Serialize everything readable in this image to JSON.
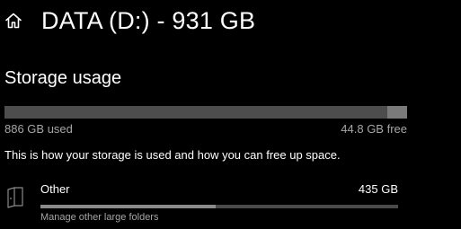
{
  "header": {
    "icon": "home-icon",
    "title": "DATA (D:) - 931 GB"
  },
  "storage": {
    "section_title": "Storage usage",
    "used_label": "886 GB used",
    "free_label": "44.8 GB free",
    "used_fraction": 0.95,
    "description": "This is how your storage is used and how you can free up space."
  },
  "categories": [
    {
      "icon": "folder-icon",
      "name": "Other",
      "size": "435 GB",
      "fill_fraction": 0.49,
      "subtitle": "Manage other large folders"
    }
  ],
  "colors": {
    "background": "#000000",
    "text": "#ffffff",
    "secondary_text": "#a6a6a6",
    "bar_track": "#7a7a7a",
    "bar_fill": "#4d4d4d"
  }
}
